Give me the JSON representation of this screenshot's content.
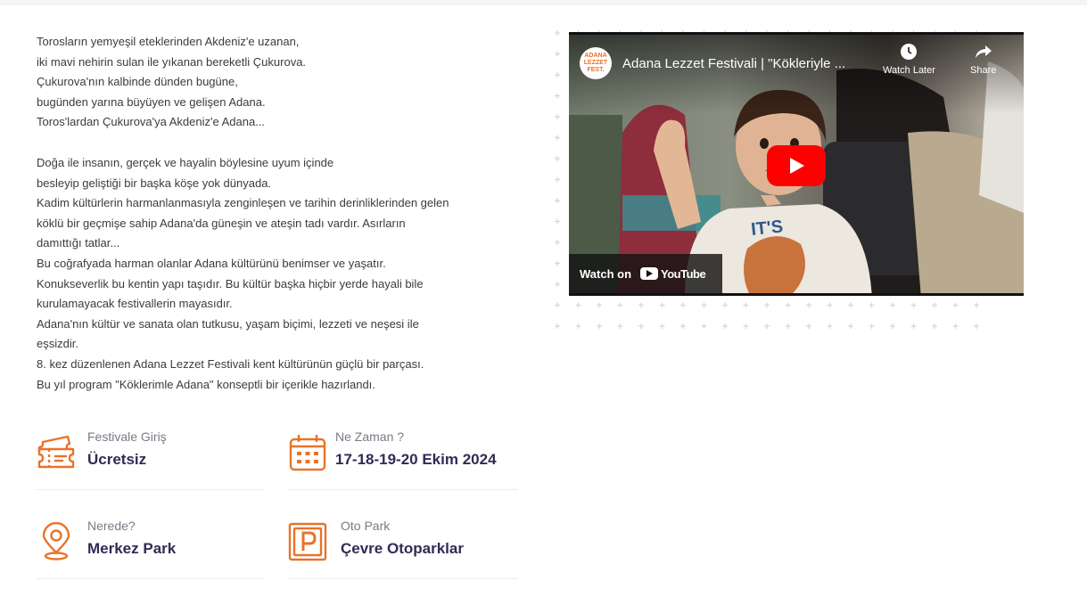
{
  "intro": {
    "paragraph1": [
      "Torosların yemyeşil eteklerinden Akdeniz'e uzanan,",
      "iki mavi nehirin sulan ile yıkanan bereketli Çukurova.",
      "Çukurova'nın kalbinde dünden bugüne,",
      "bugünden yarına büyüyen ve gelişen Adana.",
      "Toros'lardan Çukurova'ya Akdeniz'e Adana..."
    ],
    "paragraph2": [
      "Doğa ile insanın, gerçek ve hayalin böylesine uyum içinde",
      "besleyip geliştiği bir başka köşe yok dünyada.",
      "Kadim kültürlerin harmanlanmasıyla zenginleşen ve tarihin derinliklerinden gelen",
      "köklü bir geçmişe sahip Adana'da güneşin ve ateşin tadı vardır. Asırların",
      "damıttığı tatlar...",
      "Bu coğrafyada harman olanlar Adana kültürünü benimser ve yaşatır.",
      "Konukseverlik bu kentin yapı taşıdır. Bu kültür başka hiçbir yerde hayali bile",
      "kurulamayacak festivallerin mayasıdır.",
      "Adana'nın kültür ve sanata olan tutkusu, yaşam biçimi, lezzeti ve neşesi ile",
      "eşsizdir.",
      "8. kez düzenlenen Adana Lezzet Festivali kent kültürünün güçlü bir parçası.",
      "Bu yıl program \"Köklerimle Adana\" konseptli bir içerikle hazırlandı."
    ]
  },
  "info": {
    "entry": {
      "label": "Festivale Giriş",
      "value": "Ücretsiz",
      "icon": "ticket-icon"
    },
    "when": {
      "label": "Ne Zaman ?",
      "value": "17-18-19-20 Ekim 2024",
      "icon": "calendar-icon"
    },
    "where": {
      "label": "Nerede?",
      "value": "Merkez Park",
      "icon": "location-pin-icon"
    },
    "parking": {
      "label": "Oto Park",
      "value": "Çevre Otoparklar",
      "icon": "parking-icon"
    }
  },
  "video": {
    "title": "Adana Lezzet Festivali | \"Kökleriyle ...",
    "channel_logo_text": "ADANA LEZZET FEST.",
    "watch_later": "Watch Later",
    "share": "Share",
    "watch_on": "Watch on",
    "youtube": "YouTube"
  },
  "colors": {
    "accent_orange": "#e8732a",
    "value_navy": "#2f2c55",
    "label_gray": "#7a7a86",
    "youtube_red": "#ff0000"
  }
}
